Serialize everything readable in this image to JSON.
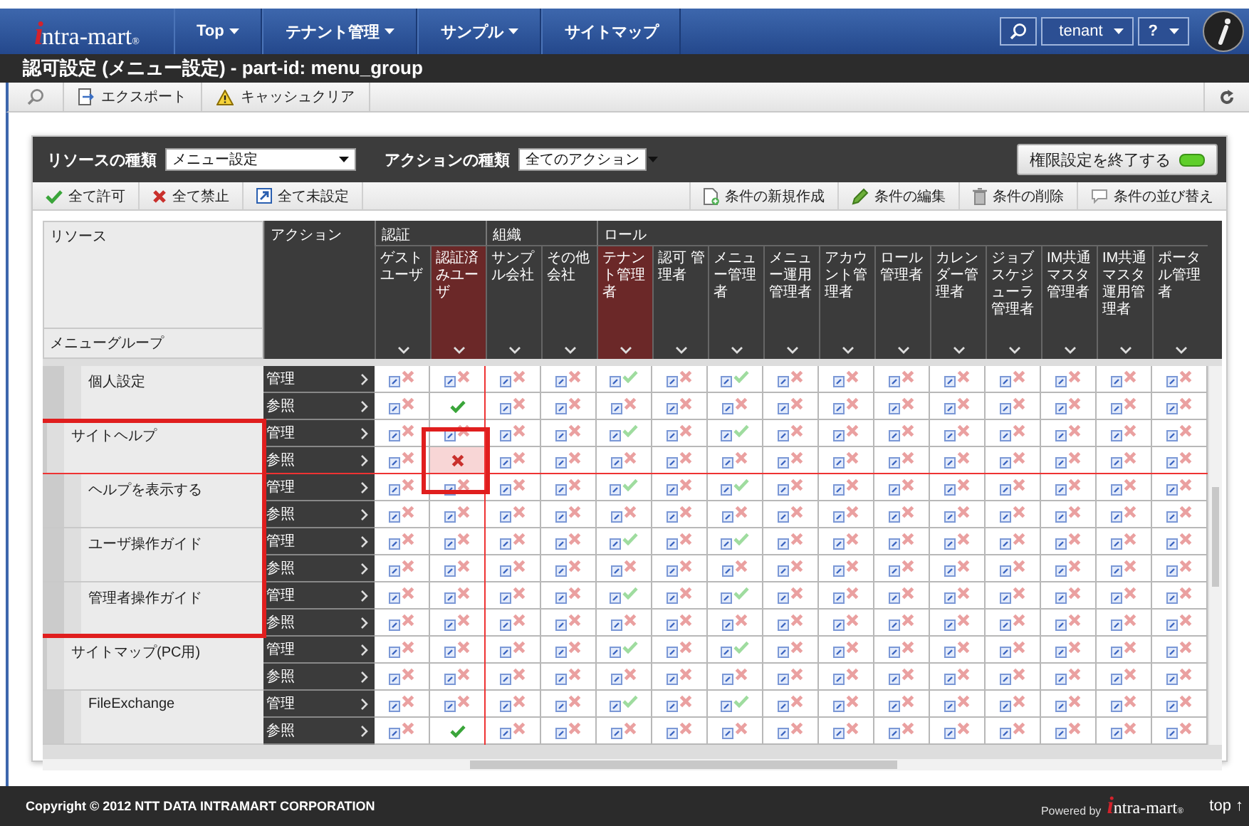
{
  "navbar": {
    "logo": {
      "initial": "i",
      "name": "ntra-mart",
      "mark": "®"
    },
    "menu": [
      {
        "label": "Top",
        "dropdown": true
      },
      {
        "label": "テナント管理",
        "dropdown": true
      },
      {
        "label": "サンプル",
        "dropdown": true
      },
      {
        "label": "サイトマップ",
        "dropdown": false
      }
    ],
    "user": "tenant",
    "help": "?"
  },
  "title": "認可設定 (メニュー設定) - part-id: menu_group",
  "toolbar": {
    "buttons": [
      {
        "kind": "export",
        "label": "エクスポート"
      },
      {
        "kind": "warning",
        "label": "キャッシュクリア"
      }
    ]
  },
  "panel": {
    "resource_type_label": "リソースの種類",
    "resource_type": "メニュー設定",
    "action_type_label": "アクションの種類",
    "action_type": "全てのアクション",
    "finish_button": "権限設定を終了する",
    "left_buttons": [
      {
        "kind": "allow",
        "label": "全て許可"
      },
      {
        "kind": "deny",
        "label": "全て禁止"
      },
      {
        "kind": "unset",
        "label": "全て未設定"
      }
    ],
    "right_buttons": [
      {
        "kind": "new",
        "label": "条件の新規作成"
      },
      {
        "kind": "edit",
        "label": "条件の編集"
      },
      {
        "kind": "delete",
        "label": "条件の削除"
      },
      {
        "kind": "sort",
        "label": "条件の並び替え"
      }
    ]
  },
  "grid": {
    "header": {
      "resource": "リソース",
      "resource_group": "メニューグループ",
      "action": "アクション"
    },
    "column_groups": [
      {
        "label": "認証",
        "columns": [
          {
            "label": "ゲストユーザ",
            "highlighted": false
          },
          {
            "label": "認証済みユーザ",
            "highlighted": true
          }
        ]
      },
      {
        "label": "組織",
        "columns": [
          {
            "label": "サンプル会社",
            "highlighted": false
          },
          {
            "label": "その他会社",
            "highlighted": false
          }
        ]
      },
      {
        "label": "ロール",
        "columns": [
          {
            "label": "テナント管理者",
            "highlighted": true
          },
          {
            "label": "認可 管理者",
            "highlighted": false
          },
          {
            "label": "メニュー管理者",
            "highlighted": false
          },
          {
            "label": "メニュー運用管理者",
            "highlighted": false
          },
          {
            "label": "アカウント管理者",
            "highlighted": false
          },
          {
            "label": "ロール管理者",
            "highlighted": false
          },
          {
            "label": "カレンダー管理者",
            "highlighted": false
          },
          {
            "label": "ジョブスケジューラ管理者",
            "highlighted": false
          },
          {
            "label": "IM共通マスタ管理者",
            "highlighted": false
          },
          {
            "label": "IM共通マスタ運用管理者",
            "highlighted": false
          },
          {
            "label": "ポータル管理者",
            "highlighted": false
          }
        ]
      }
    ],
    "resources": [
      {
        "children": [
          {
            "name": "個人設定",
            "outlined": false,
            "actions": [
              {
                "label": "管理",
                "cells": [
                  {
                    "allowed": false,
                    "inherited": true,
                    "selected": false
                  },
                  {
                    "allowed": false,
                    "inherited": true,
                    "selected": false
                  },
                  {
                    "allowed": false,
                    "inherited": true,
                    "selected": false
                  },
                  {
                    "allowed": false,
                    "inherited": true,
                    "selected": false
                  },
                  {
                    "allowed": true,
                    "inherited": true,
                    "selected": false
                  },
                  {
                    "allowed": false,
                    "inherited": true,
                    "selected": false
                  },
                  {
                    "allowed": true,
                    "inherited": true,
                    "selected": false
                  },
                  {
                    "allowed": false,
                    "inherited": true,
                    "selected": false
                  },
                  {
                    "allowed": false,
                    "inherited": true,
                    "selected": false
                  },
                  {
                    "allowed": false,
                    "inherited": true,
                    "selected": false
                  },
                  {
                    "allowed": false,
                    "inherited": true,
                    "selected": false
                  },
                  {
                    "allowed": false,
                    "inherited": true,
                    "selected": false
                  },
                  {
                    "allowed": false,
                    "inherited": true,
                    "selected": false
                  },
                  {
                    "allowed": false,
                    "inherited": true,
                    "selected": false
                  },
                  {
                    "allowed": false,
                    "inherited": true,
                    "selected": false
                  }
                ]
              },
              {
                "label": "参照",
                "cells": [
                  {
                    "allowed": false,
                    "inherited": true,
                    "selected": false
                  },
                  {
                    "allowed": true,
                    "inherited": false,
                    "selected": false
                  },
                  {
                    "allowed": false,
                    "inherited": true,
                    "selected": false
                  },
                  {
                    "allowed": false,
                    "inherited": true,
                    "selected": false
                  },
                  {
                    "allowed": false,
                    "inherited": true,
                    "selected": false
                  },
                  {
                    "allowed": false,
                    "inherited": true,
                    "selected": false
                  },
                  {
                    "allowed": false,
                    "inherited": true,
                    "selected": false
                  },
                  {
                    "allowed": false,
                    "inherited": true,
                    "selected": false
                  },
                  {
                    "allowed": false,
                    "inherited": true,
                    "selected": false
                  },
                  {
                    "allowed": false,
                    "inherited": true,
                    "selected": false
                  },
                  {
                    "allowed": false,
                    "inherited": true,
                    "selected": false
                  },
                  {
                    "allowed": false,
                    "inherited": true,
                    "selected": false
                  },
                  {
                    "allowed": false,
                    "inherited": true,
                    "selected": false
                  },
                  {
                    "allowed": false,
                    "inherited": true,
                    "selected": false
                  },
                  {
                    "allowed": false,
                    "inherited": true,
                    "selected": false
                  }
                ]
              }
            ]
          }
        ]
      },
      {
        "name": "サイトヘルプ",
        "outlined": true,
        "actions": [
          {
            "label": "管理",
            "cells": [
              {
                "allowed": false,
                "inherited": true,
                "selected": false
              },
              {
                "allowed": false,
                "inherited": true,
                "selected": false
              },
              {
                "allowed": false,
                "inherited": true,
                "selected": false
              },
              {
                "allowed": false,
                "inherited": true,
                "selected": false
              },
              {
                "allowed": true,
                "inherited": true,
                "selected": false
              },
              {
                "allowed": false,
                "inherited": true,
                "selected": false
              },
              {
                "allowed": true,
                "inherited": true,
                "selected": false
              },
              {
                "allowed": false,
                "inherited": true,
                "selected": false
              },
              {
                "allowed": false,
                "inherited": true,
                "selected": false
              },
              {
                "allowed": false,
                "inherited": true,
                "selected": false
              },
              {
                "allowed": false,
                "inherited": true,
                "selected": false
              },
              {
                "allowed": false,
                "inherited": true,
                "selected": false
              },
              {
                "allowed": false,
                "inherited": true,
                "selected": false
              },
              {
                "allowed": false,
                "inherited": true,
                "selected": false
              },
              {
                "allowed": false,
                "inherited": true,
                "selected": false
              }
            ]
          },
          {
            "label": "参照",
            "cells": [
              {
                "allowed": false,
                "inherited": true,
                "selected": false
              },
              {
                "allowed": false,
                "inherited": false,
                "selected": true
              },
              {
                "allowed": false,
                "inherited": true,
                "selected": false
              },
              {
                "allowed": false,
                "inherited": true,
                "selected": false
              },
              {
                "allowed": false,
                "inherited": true,
                "selected": false
              },
              {
                "allowed": false,
                "inherited": true,
                "selected": false
              },
              {
                "allowed": false,
                "inherited": true,
                "selected": false
              },
              {
                "allowed": false,
                "inherited": true,
                "selected": false
              },
              {
                "allowed": false,
                "inherited": true,
                "selected": false
              },
              {
                "allowed": false,
                "inherited": true,
                "selected": false
              },
              {
                "allowed": false,
                "inherited": true,
                "selected": false
              },
              {
                "allowed": false,
                "inherited": true,
                "selected": false
              },
              {
                "allowed": false,
                "inherited": true,
                "selected": false
              },
              {
                "allowed": false,
                "inherited": true,
                "selected": false
              },
              {
                "allowed": false,
                "inherited": true,
                "selected": false
              }
            ]
          }
        ],
        "children": [
          {
            "name": "ヘルプを表示する",
            "outlined": false,
            "actions": [
              {
                "label": "管理",
                "cells": [
                  {
                    "allowed": false,
                    "inherited": true,
                    "selected": false
                  },
                  {
                    "allowed": false,
                    "inherited": true,
                    "selected": false
                  },
                  {
                    "allowed": false,
                    "inherited": true,
                    "selected": false
                  },
                  {
                    "allowed": false,
                    "inherited": true,
                    "selected": false
                  },
                  {
                    "allowed": true,
                    "inherited": true,
                    "selected": false
                  },
                  {
                    "allowed": false,
                    "inherited": true,
                    "selected": false
                  },
                  {
                    "allowed": true,
                    "inherited": true,
                    "selected": false
                  },
                  {
                    "allowed": false,
                    "inherited": true,
                    "selected": false
                  },
                  {
                    "allowed": false,
                    "inherited": true,
                    "selected": false
                  },
                  {
                    "allowed": false,
                    "inherited": true,
                    "selected": false
                  },
                  {
                    "allowed": false,
                    "inherited": true,
                    "selected": false
                  },
                  {
                    "allowed": false,
                    "inherited": true,
                    "selected": false
                  },
                  {
                    "allowed": false,
                    "inherited": true,
                    "selected": false
                  },
                  {
                    "allowed": false,
                    "inherited": true,
                    "selected": false
                  },
                  {
                    "allowed": false,
                    "inherited": true,
                    "selected": false
                  }
                ]
              },
              {
                "label": "参照",
                "cells": [
                  {
                    "allowed": false,
                    "inherited": true,
                    "selected": false
                  },
                  {
                    "allowed": false,
                    "inherited": true,
                    "selected": false
                  },
                  {
                    "allowed": false,
                    "inherited": true,
                    "selected": false
                  },
                  {
                    "allowed": false,
                    "inherited": true,
                    "selected": false
                  },
                  {
                    "allowed": false,
                    "inherited": true,
                    "selected": false
                  },
                  {
                    "allowed": false,
                    "inherited": true,
                    "selected": false
                  },
                  {
                    "allowed": false,
                    "inherited": true,
                    "selected": false
                  },
                  {
                    "allowed": false,
                    "inherited": true,
                    "selected": false
                  },
                  {
                    "allowed": false,
                    "inherited": true,
                    "selected": false
                  },
                  {
                    "allowed": false,
                    "inherited": true,
                    "selected": false
                  },
                  {
                    "allowed": false,
                    "inherited": true,
                    "selected": false
                  },
                  {
                    "allowed": false,
                    "inherited": true,
                    "selected": false
                  },
                  {
                    "allowed": false,
                    "inherited": true,
                    "selected": false
                  },
                  {
                    "allowed": false,
                    "inherited": true,
                    "selected": false
                  },
                  {
                    "allowed": false,
                    "inherited": true,
                    "selected": false
                  }
                ]
              }
            ]
          },
          {
            "name": "ユーザ操作ガイド",
            "outlined": false,
            "actions": [
              {
                "label": "管理",
                "cells": [
                  {
                    "allowed": false,
                    "inherited": true,
                    "selected": false
                  },
                  {
                    "allowed": false,
                    "inherited": true,
                    "selected": false
                  },
                  {
                    "allowed": false,
                    "inherited": true,
                    "selected": false
                  },
                  {
                    "allowed": false,
                    "inherited": true,
                    "selected": false
                  },
                  {
                    "allowed": true,
                    "inherited": true,
                    "selected": false
                  },
                  {
                    "allowed": false,
                    "inherited": true,
                    "selected": false
                  },
                  {
                    "allowed": true,
                    "inherited": true,
                    "selected": false
                  },
                  {
                    "allowed": false,
                    "inherited": true,
                    "selected": false
                  },
                  {
                    "allowed": false,
                    "inherited": true,
                    "selected": false
                  },
                  {
                    "allowed": false,
                    "inherited": true,
                    "selected": false
                  },
                  {
                    "allowed": false,
                    "inherited": true,
                    "selected": false
                  },
                  {
                    "allowed": false,
                    "inherited": true,
                    "selected": false
                  },
                  {
                    "allowed": false,
                    "inherited": true,
                    "selected": false
                  },
                  {
                    "allowed": false,
                    "inherited": true,
                    "selected": false
                  },
                  {
                    "allowed": false,
                    "inherited": true,
                    "selected": false
                  }
                ]
              },
              {
                "label": "参照",
                "cells": [
                  {
                    "allowed": false,
                    "inherited": true,
                    "selected": false
                  },
                  {
                    "allowed": false,
                    "inherited": true,
                    "selected": false
                  },
                  {
                    "allowed": false,
                    "inherited": true,
                    "selected": false
                  },
                  {
                    "allowed": false,
                    "inherited": true,
                    "selected": false
                  },
                  {
                    "allowed": false,
                    "inherited": true,
                    "selected": false
                  },
                  {
                    "allowed": false,
                    "inherited": true,
                    "selected": false
                  },
                  {
                    "allowed": false,
                    "inherited": true,
                    "selected": false
                  },
                  {
                    "allowed": false,
                    "inherited": true,
                    "selected": false
                  },
                  {
                    "allowed": false,
                    "inherited": true,
                    "selected": false
                  },
                  {
                    "allowed": false,
                    "inherited": true,
                    "selected": false
                  },
                  {
                    "allowed": false,
                    "inherited": true,
                    "selected": false
                  },
                  {
                    "allowed": false,
                    "inherited": true,
                    "selected": false
                  },
                  {
                    "allowed": false,
                    "inherited": true,
                    "selected": false
                  },
                  {
                    "allowed": false,
                    "inherited": true,
                    "selected": false
                  },
                  {
                    "allowed": false,
                    "inherited": true,
                    "selected": false
                  }
                ]
              }
            ]
          },
          {
            "name": "管理者操作ガイド",
            "outlined": false,
            "actions": [
              {
                "label": "管理",
                "cells": [
                  {
                    "allowed": false,
                    "inherited": true,
                    "selected": false
                  },
                  {
                    "allowed": false,
                    "inherited": true,
                    "selected": false
                  },
                  {
                    "allowed": false,
                    "inherited": true,
                    "selected": false
                  },
                  {
                    "allowed": false,
                    "inherited": true,
                    "selected": false
                  },
                  {
                    "allowed": true,
                    "inherited": true,
                    "selected": false
                  },
                  {
                    "allowed": false,
                    "inherited": true,
                    "selected": false
                  },
                  {
                    "allowed": true,
                    "inherited": true,
                    "selected": false
                  },
                  {
                    "allowed": false,
                    "inherited": true,
                    "selected": false
                  },
                  {
                    "allowed": false,
                    "inherited": true,
                    "selected": false
                  },
                  {
                    "allowed": false,
                    "inherited": true,
                    "selected": false
                  },
                  {
                    "allowed": false,
                    "inherited": true,
                    "selected": false
                  },
                  {
                    "allowed": false,
                    "inherited": true,
                    "selected": false
                  },
                  {
                    "allowed": false,
                    "inherited": true,
                    "selected": false
                  },
                  {
                    "allowed": false,
                    "inherited": true,
                    "selected": false
                  },
                  {
                    "allowed": false,
                    "inherited": true,
                    "selected": false
                  }
                ]
              },
              {
                "label": "参照",
                "cells": [
                  {
                    "allowed": false,
                    "inherited": true,
                    "selected": false
                  },
                  {
                    "allowed": false,
                    "inherited": true,
                    "selected": false
                  },
                  {
                    "allowed": false,
                    "inherited": true,
                    "selected": false
                  },
                  {
                    "allowed": false,
                    "inherited": true,
                    "selected": false
                  },
                  {
                    "allowed": false,
                    "inherited": true,
                    "selected": false
                  },
                  {
                    "allowed": false,
                    "inherited": true,
                    "selected": false
                  },
                  {
                    "allowed": false,
                    "inherited": true,
                    "selected": false
                  },
                  {
                    "allowed": false,
                    "inherited": true,
                    "selected": false
                  },
                  {
                    "allowed": false,
                    "inherited": true,
                    "selected": false
                  },
                  {
                    "allowed": false,
                    "inherited": true,
                    "selected": false
                  },
                  {
                    "allowed": false,
                    "inherited": true,
                    "selected": false
                  },
                  {
                    "allowed": false,
                    "inherited": true,
                    "selected": false
                  },
                  {
                    "allowed": false,
                    "inherited": true,
                    "selected": false
                  },
                  {
                    "allowed": false,
                    "inherited": true,
                    "selected": false
                  },
                  {
                    "allowed": false,
                    "inherited": true,
                    "selected": false
                  }
                ]
              }
            ]
          }
        ]
      },
      {
        "name": "サイトマップ(PC用)",
        "outlined": false,
        "actions": [
          {
            "label": "管理",
            "cells": [
              {
                "allowed": false,
                "inherited": true,
                "selected": false
              },
              {
                "allowed": false,
                "inherited": true,
                "selected": false
              },
              {
                "allowed": false,
                "inherited": true,
                "selected": false
              },
              {
                "allowed": false,
                "inherited": true,
                "selected": false
              },
              {
                "allowed": true,
                "inherited": true,
                "selected": false
              },
              {
                "allowed": false,
                "inherited": true,
                "selected": false
              },
              {
                "allowed": true,
                "inherited": true,
                "selected": false
              },
              {
                "allowed": false,
                "inherited": true,
                "selected": false
              },
              {
                "allowed": false,
                "inherited": true,
                "selected": false
              },
              {
                "allowed": false,
                "inherited": true,
                "selected": false
              },
              {
                "allowed": false,
                "inherited": true,
                "selected": false
              },
              {
                "allowed": false,
                "inherited": true,
                "selected": false
              },
              {
                "allowed": false,
                "inherited": true,
                "selected": false
              },
              {
                "allowed": false,
                "inherited": true,
                "selected": false
              },
              {
                "allowed": false,
                "inherited": true,
                "selected": false
              }
            ]
          },
          {
            "label": "参照",
            "cells": [
              {
                "allowed": false,
                "inherited": true,
                "selected": false
              },
              {
                "allowed": false,
                "inherited": true,
                "selected": false
              },
              {
                "allowed": false,
                "inherited": true,
                "selected": false
              },
              {
                "allowed": false,
                "inherited": true,
                "selected": false
              },
              {
                "allowed": false,
                "inherited": true,
                "selected": false
              },
              {
                "allowed": false,
                "inherited": true,
                "selected": false
              },
              {
                "allowed": false,
                "inherited": true,
                "selected": false
              },
              {
                "allowed": false,
                "inherited": true,
                "selected": false
              },
              {
                "allowed": false,
                "inherited": true,
                "selected": false
              },
              {
                "allowed": false,
                "inherited": true,
                "selected": false
              },
              {
                "allowed": false,
                "inherited": true,
                "selected": false
              },
              {
                "allowed": false,
                "inherited": true,
                "selected": false
              },
              {
                "allowed": false,
                "inherited": true,
                "selected": false
              },
              {
                "allowed": false,
                "inherited": true,
                "selected": false
              },
              {
                "allowed": false,
                "inherited": true,
                "selected": false
              }
            ]
          }
        ],
        "children": [
          {
            "name": "FileExchange",
            "outlined": false,
            "actions": [
              {
                "label": "管理",
                "cells": [
                  {
                    "allowed": false,
                    "inherited": true,
                    "selected": false
                  },
                  {
                    "allowed": false,
                    "inherited": true,
                    "selected": false
                  },
                  {
                    "allowed": false,
                    "inherited": true,
                    "selected": false
                  },
                  {
                    "allowed": false,
                    "inherited": true,
                    "selected": false
                  },
                  {
                    "allowed": true,
                    "inherited": true,
                    "selected": false
                  },
                  {
                    "allowed": false,
                    "inherited": true,
                    "selected": false
                  },
                  {
                    "allowed": true,
                    "inherited": true,
                    "selected": false
                  },
                  {
                    "allowed": false,
                    "inherited": true,
                    "selected": false
                  },
                  {
                    "allowed": false,
                    "inherited": true,
                    "selected": false
                  },
                  {
                    "allowed": false,
                    "inherited": true,
                    "selected": false
                  },
                  {
                    "allowed": false,
                    "inherited": true,
                    "selected": false
                  },
                  {
                    "allowed": false,
                    "inherited": true,
                    "selected": false
                  },
                  {
                    "allowed": false,
                    "inherited": true,
                    "selected": false
                  },
                  {
                    "allowed": false,
                    "inherited": true,
                    "selected": false
                  },
                  {
                    "allowed": false,
                    "inherited": true,
                    "selected": false
                  }
                ]
              },
              {
                "label": "参照",
                "cells": [
                  {
                    "allowed": false,
                    "inherited": true,
                    "selected": false
                  },
                  {
                    "allowed": true,
                    "inherited": false,
                    "selected": false
                  },
                  {
                    "allowed": false,
                    "inherited": true,
                    "selected": false
                  },
                  {
                    "allowed": false,
                    "inherited": true,
                    "selected": false
                  },
                  {
                    "allowed": false,
                    "inherited": true,
                    "selected": false
                  },
                  {
                    "allowed": false,
                    "inherited": true,
                    "selected": false
                  },
                  {
                    "allowed": false,
                    "inherited": true,
                    "selected": false
                  },
                  {
                    "allowed": false,
                    "inherited": true,
                    "selected": false
                  },
                  {
                    "allowed": false,
                    "inherited": true,
                    "selected": false
                  },
                  {
                    "allowed": false,
                    "inherited": true,
                    "selected": false
                  },
                  {
                    "allowed": false,
                    "inherited": true,
                    "selected": false
                  },
                  {
                    "allowed": false,
                    "inherited": true,
                    "selected": false
                  },
                  {
                    "allowed": false,
                    "inherited": true,
                    "selected": false
                  },
                  {
                    "allowed": false,
                    "inherited": true,
                    "selected": false
                  },
                  {
                    "allowed": false,
                    "inherited": true,
                    "selected": false
                  }
                ]
              }
            ]
          }
        ]
      }
    ]
  },
  "footer": {
    "copyright": "Copyright © 2012 NTT DATA INTRAMART CORPORATION",
    "powered_by": "Powered by",
    "logo": {
      "initial": "i",
      "name": "ntra-mart",
      "mark": "®"
    },
    "top_link": "top ↑"
  }
}
